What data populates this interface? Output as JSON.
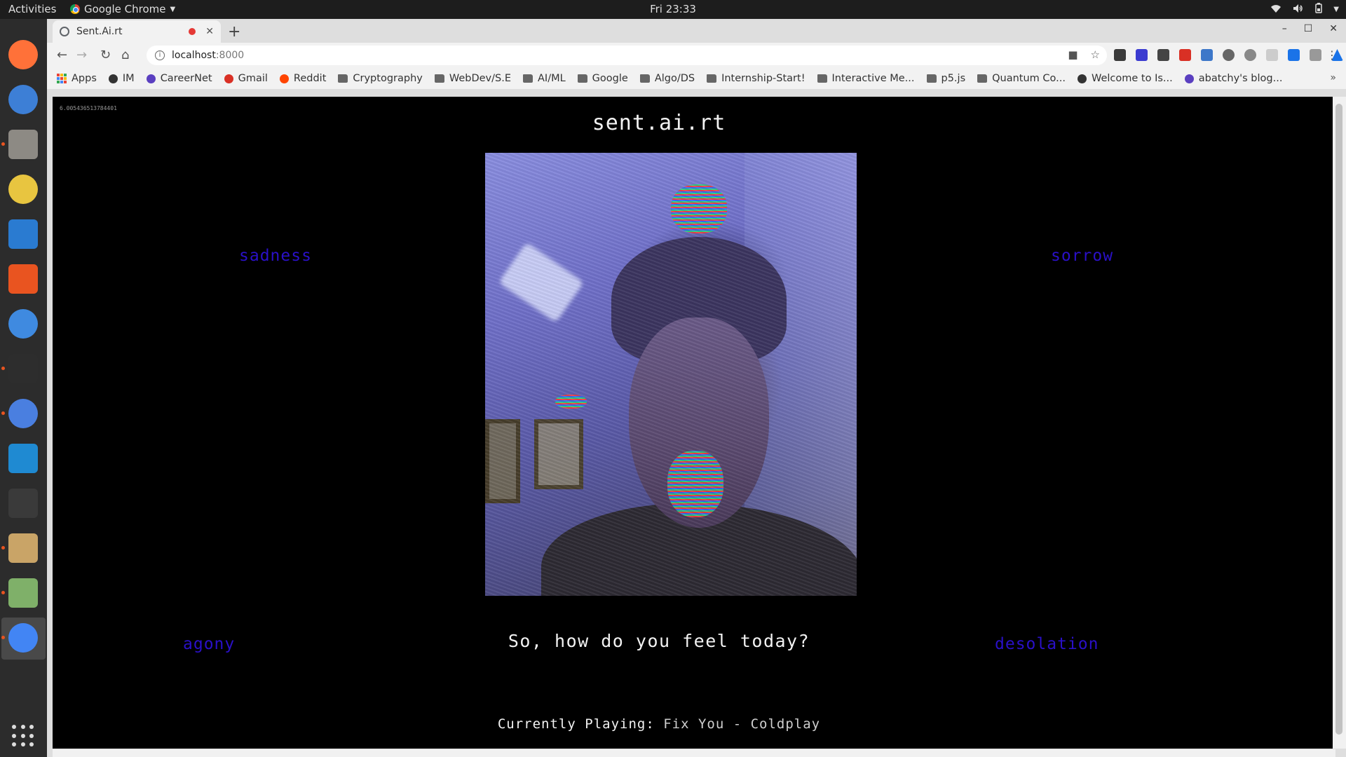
{
  "topbar": {
    "activities": "Activities",
    "app_name": "Google Chrome",
    "clock": "Fri 23:33"
  },
  "dock": {
    "items": [
      {
        "name": "firefox-icon",
        "color": "#ff7139"
      },
      {
        "name": "thunderbird-icon",
        "color": "#3d7fd6"
      },
      {
        "name": "files-icon",
        "color": "#8d8a84"
      },
      {
        "name": "rhythmbox-icon",
        "color": "#e8c540"
      },
      {
        "name": "libreoffice-writer-icon",
        "color": "#2a7bd1"
      },
      {
        "name": "software-center-icon",
        "color": "#e95420"
      },
      {
        "name": "help-icon",
        "color": "#3f8ae0"
      },
      {
        "name": "terminal-icon",
        "color": "#2d2d2d"
      },
      {
        "name": "chromium-icon",
        "color": "#4a7fe0"
      },
      {
        "name": "vscode-icon",
        "color": "#1f8ad2"
      },
      {
        "name": "video-editor-icon",
        "color": "#3a3a3a"
      },
      {
        "name": "archive-manager-icon",
        "color": "#c9a467"
      },
      {
        "name": "image-viewer-icon",
        "color": "#7fb069"
      },
      {
        "name": "google-chrome-icon",
        "color": "#4285f4"
      }
    ]
  },
  "browser": {
    "tab_title": "Sent.Ai.rt",
    "url_host": "localhost",
    "url_port": ":8000",
    "bookmarks": [
      {
        "label": "Apps",
        "type": "apps"
      },
      {
        "label": "IM",
        "type": "site"
      },
      {
        "label": "CareerNet",
        "type": "site"
      },
      {
        "label": "Gmail",
        "type": "site"
      },
      {
        "label": "Reddit",
        "type": "site"
      },
      {
        "label": "Cryptography",
        "type": "folder"
      },
      {
        "label": "WebDev/S.E",
        "type": "folder"
      },
      {
        "label": "AI/ML",
        "type": "folder"
      },
      {
        "label": "Google",
        "type": "folder"
      },
      {
        "label": "Algo/DS",
        "type": "folder"
      },
      {
        "label": "Internship-Start!",
        "type": "folder"
      },
      {
        "label": "Interactive Me...",
        "type": "folder"
      },
      {
        "label": "p5.js",
        "type": "folder"
      },
      {
        "label": "Quantum Co...",
        "type": "folder"
      },
      {
        "label": "Welcome to Is...",
        "type": "site"
      },
      {
        "label": "abatchy's blog...",
        "type": "site"
      }
    ]
  },
  "page": {
    "fps": "6.005436513784401",
    "title": "sent.ai.rt",
    "emotions": {
      "top_left": "sadness",
      "top_right": "sorrow",
      "bottom_left": "agony",
      "bottom_right": "desolation"
    },
    "emotion_color": "#2a10c8",
    "question": "So, how do you feel today?",
    "playing_label": "Currently Playing:",
    "playing_song": "Fix You - Coldplay"
  }
}
